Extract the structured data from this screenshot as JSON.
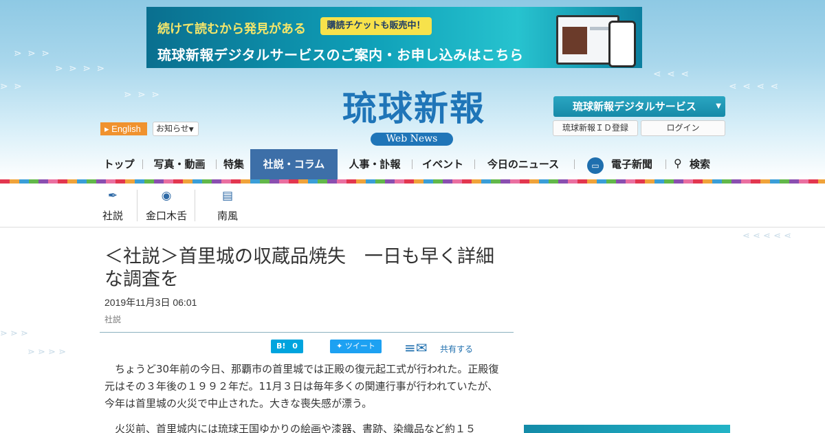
{
  "banner": {
    "top_text": "続けて読むから発見がある",
    "badge": "購読チケットも販売中！",
    "main_text": "琉球新報デジタルサービスのご案内・お申し込みはこちら"
  },
  "header": {
    "logo": "琉球新報",
    "logo_sub": "Web News",
    "english": "English",
    "notice": "お知らせ",
    "digital_service": "琉球新報デジタルサービス",
    "id_register": "琉球新報ＩＤ登録",
    "login": "ログイン"
  },
  "nav": {
    "items": [
      "トップ",
      "写真・動画",
      "特集",
      "社説・コラム",
      "人事・訃報",
      "イベント",
      "今日のニュース",
      "電子新聞",
      "検索"
    ],
    "active": "社説・コラム"
  },
  "subnav": {
    "items": [
      "社説",
      "金口木舌",
      "南風"
    ]
  },
  "article": {
    "title": "＜社説＞首里城の収蔵品焼失　一日も早く詳細な調査を",
    "date": "2019年11月3日 06:01",
    "category": "社説",
    "hatena_label": "B!",
    "hatena_count": "0",
    "tweet": "ツイート",
    "share": "共有する",
    "paragraphs": [
      "ちょうど30年前の今日、那覇市の首里城では正殿の復元起工式が行われた。正殿復元はその３年後の１９９２年だ。11月３日は毎年多くの関連行事が行われていたが、今年は首里城の火災で中止された。大きな喪失感が漂う。",
      "火災前、首里城内には琉球王国ゆかりの絵画や漆器、書跡、染織品など約１５"
    ]
  },
  "colors": {
    "accent": "#1f75b8",
    "nav_active": "#3d6fa8",
    "english_btn": "#f0922e",
    "digital_btn": "#168aa8"
  }
}
